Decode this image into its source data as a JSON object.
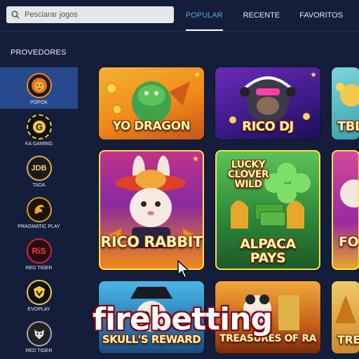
{
  "search": {
    "placeholder": "Pesciarar jogos",
    "icon": "search-icon"
  },
  "tabs": [
    {
      "label": "POPULAR",
      "active": true
    },
    {
      "label": "RECENTE",
      "active": false
    },
    {
      "label": "FAVORITOS",
      "active": false
    }
  ],
  "sidebar": {
    "title": "PROVEDORES",
    "items": [
      {
        "name": "POPOK",
        "icon": "lion-logo-icon",
        "active": true
      },
      {
        "name": "KA GAMING",
        "icon": "g-logo-icon",
        "active": false
      },
      {
        "name": "TADA",
        "icon": "jdb-logo-icon",
        "logo_text": "JDB",
        "active": false
      },
      {
        "name": "PRAGMATIC PLAY",
        "icon": "dragon-logo-icon",
        "active": false
      },
      {
        "name": "RED TIGER",
        "icon": "rt-logo-icon",
        "logo_text": "RiS",
        "active": false
      },
      {
        "name": "EVOPLAY",
        "icon": "evoplay-logo-icon",
        "active": false
      },
      {
        "name": "RED TIGER",
        "icon": "tiger-logo-icon",
        "active": false
      }
    ]
  },
  "games": {
    "yo_dragon": "YO DRAGON",
    "rico_dj": "RICO DJ",
    "tbl": "TBL",
    "rico_rabbit": "RICO RABBIT",
    "lucky_clover": "LUCKY CLOVER WILD",
    "alpaca_pays": "ALPACA PAYS",
    "for": "FOR",
    "skulls_reward": "SKULL'S REWARD",
    "treasures_of_ra": "TREASURES OF RA",
    "trea": "TREA"
  },
  "watermark": "firebetting",
  "colors": {
    "background": "#141d3a",
    "active_tab": "#5aa8f0",
    "active_provider": "#274a8c",
    "favorite_star": "#ffe14a"
  }
}
